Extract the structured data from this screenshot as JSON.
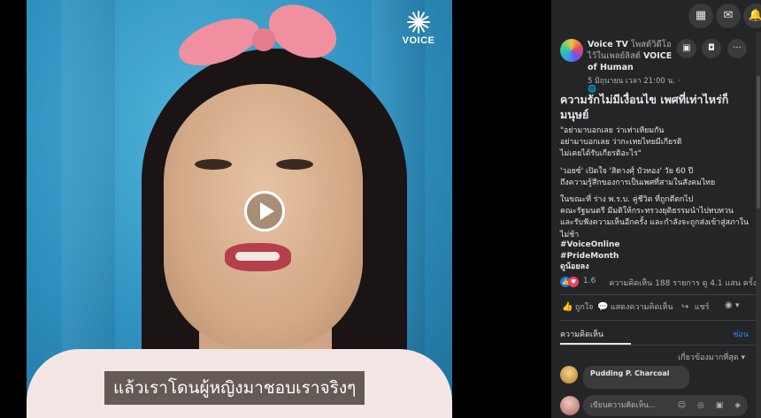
{
  "video": {
    "logo_text": "VOICE",
    "subtitle": "แล้วเราโดนผู้หญิงมาชอบเราจริงๆ",
    "play_icon": "play-icon"
  },
  "topbar": {
    "menu_icon": "▦",
    "messenger_icon": "✉",
    "notification_icon": "🔔"
  },
  "post": {
    "author_name": "Voice TV",
    "author_action": "โพสต์วิดีโอไว้ในเพลย์ลิสต์",
    "playlist": "VOICE of Human",
    "time": "5 มิถุนายน เวลา 21:00 น. ·",
    "privacy_icon": "🌐",
    "title": "ความรักไม่มีเงื่อนไข เพศที่เท่าไหร่ก็มนุษย์",
    "paragraphs": [
      "\"อย่ามาบอกเลย ว่าเท่าเทียมกัน\nอย่ามาบอกเลย ว่ากะเทยไทยมีเกียรติ\nไม่เคยได้รับเกียรติอะไร\"",
      "'วอยซ์' เปิดใจ 'สิตางศุ์ บัวทอง' วัย 60 ปี\nถึงความรู้สึกของการเป็นเพศที่สามในสังคมไทย",
      "ในขณะที่ ร่าง พ.ร.บ. คู่ชีวิต ที่ถูกตีตกไป\nคณะรัฐมนตรี มีมติให้กระทรวงยุติธรรมนำไปทบทวน\nและรับฟังความเห็นอีกครั้ง และกำลังจะถูกส่งเข้าสู่สภาในไม่ช้า"
    ],
    "hashtags": [
      "#VoiceOnline",
      "#PrideMonth",
      "ดูน้อยลง"
    ],
    "reaction_count": "1.6",
    "stats_right": "ความคิดเห็น 188 รายการ  ดู 4.1 แสน ครั้ง",
    "like_label": "ถูกใจ",
    "comment_label": "แสดงความคิดเห็น",
    "share_label": "แชร์"
  },
  "comments": {
    "tab_label": "ความคิดเห็น",
    "hide_label": "ซ่อน",
    "sort_label": "เกี่ยวข้องมากที่สุด ▾",
    "first_comment_author": "Pudding P. Charcoal",
    "input_placeholder": "เขียนความคิดเห็น...",
    "input_icons": "☺ ◎ ▣ ◈"
  },
  "colors": {
    "panel_bg": "#242526",
    "accent_blue": "#2d88ff",
    "like_blue": "#1877f2",
    "love_red": "#f33e58"
  }
}
